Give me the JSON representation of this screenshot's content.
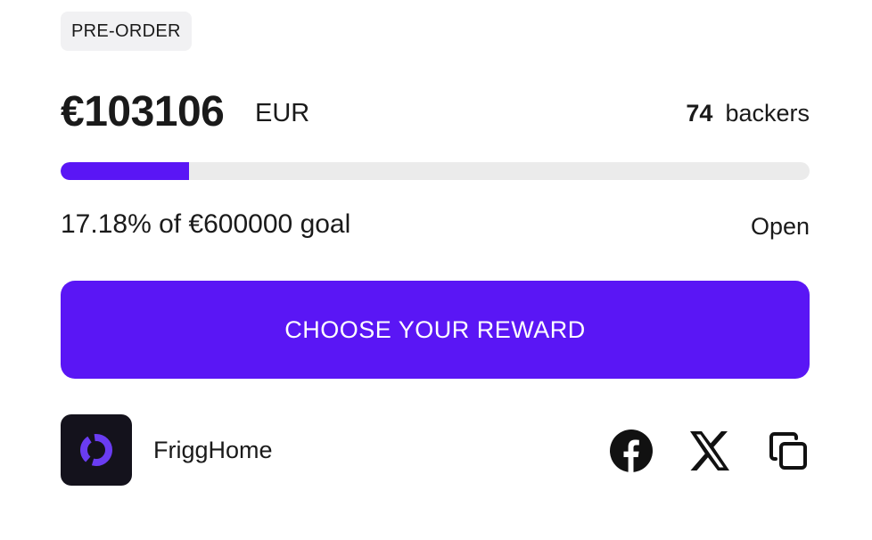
{
  "badge": "PRE-ORDER",
  "funding": {
    "amount": "€103106",
    "currency": "EUR",
    "backers_count": "74",
    "backers_label": "backers",
    "progress_fraction": 0.1718,
    "goal_text": "17.18% of €600000 goal",
    "status": "Open"
  },
  "cta": {
    "label": "CHOOSE YOUR REWARD"
  },
  "creator": {
    "name": "FriggHome"
  },
  "share": {
    "icons": [
      "facebook-icon",
      "x-icon",
      "copy-link-icon"
    ]
  },
  "colors": {
    "accent": "#5a16f5",
    "track": "#ebebeb",
    "badge_bg": "#f1f1f3",
    "logo_bg": "#14121c"
  }
}
